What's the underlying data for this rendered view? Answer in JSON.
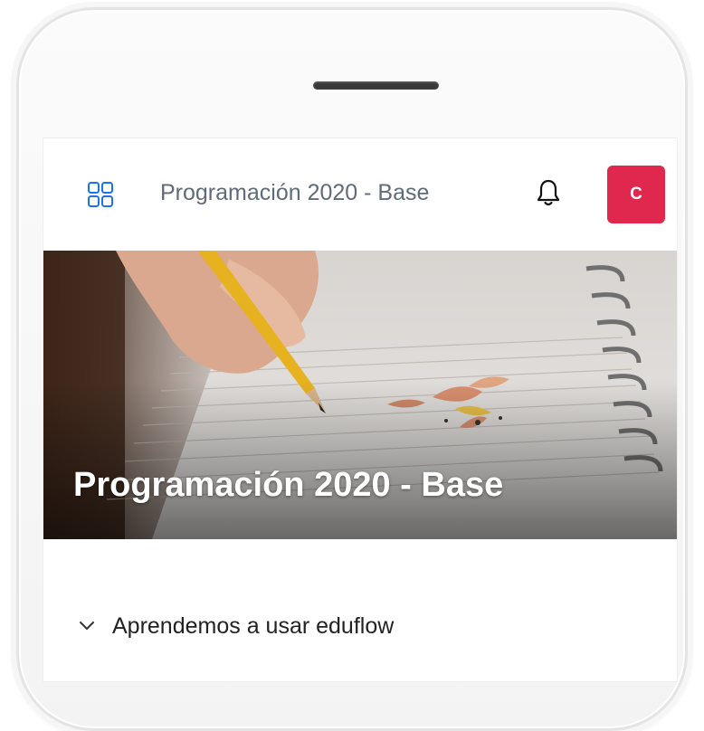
{
  "header": {
    "title": "Programación 2020 - Base",
    "avatar_initial": "C",
    "apps_icon": "grid-apps-icon",
    "bell_icon": "bell-icon"
  },
  "hero": {
    "title": "Programación 2020 - Base"
  },
  "sections": [
    {
      "label": "Aprendemos a usar eduflow",
      "icon": "chevron-down-icon"
    }
  ],
  "colors": {
    "accent": "#1a73e8",
    "avatar_bg": "#e0284f",
    "header_text": "#5f6b7a"
  }
}
